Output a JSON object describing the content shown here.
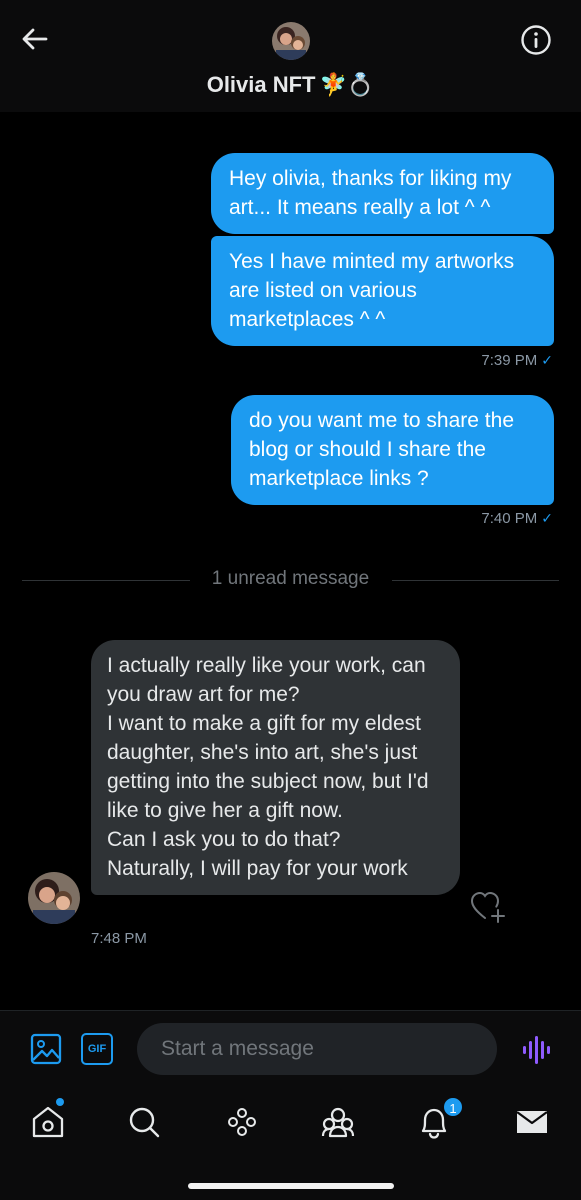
{
  "header": {
    "title": "Olivia NFT",
    "title_emoji": "🧚💍",
    "back_icon": "arrow-left-icon",
    "info_icon": "info-icon"
  },
  "conversation": {
    "outgoing": [
      {
        "text": "Hey olivia, thanks for liking my art... It means really a lot ^ ^"
      },
      {
        "text": "Yes I have minted my artworks are listed on various marketplaces ^ ^",
        "time": "7:39 PM"
      },
      {
        "text": "do you want me to share the blog or should I share the marketplace links ?",
        "time": "7:40 PM"
      }
    ],
    "read_check": "✓",
    "unread_divider": "1 unread message",
    "incoming": {
      "text": "I actually really like your work, can you draw art for me?\nI want to make a gift for my eldest daughter, she's into art, she's just getting into the subject now, but I'd like to give her a gift now.\nCan I ask you to do that?\nNaturally, I will pay for your work",
      "time": "7:48 PM"
    }
  },
  "composer": {
    "gif_label": "GIF",
    "placeholder": "Start a message",
    "media_icon": "image-icon",
    "voice_icon": "voice-message-icon"
  },
  "nav": {
    "notifications_count": "1",
    "items": [
      "home-icon",
      "search-icon",
      "spaces-icon",
      "communities-icon",
      "notifications-icon",
      "messages-icon"
    ]
  },
  "colors": {
    "accent": "#1d9bf0",
    "incoming_bubble": "#2f3336",
    "background": "#000000",
    "voice": "#8f5bff"
  }
}
